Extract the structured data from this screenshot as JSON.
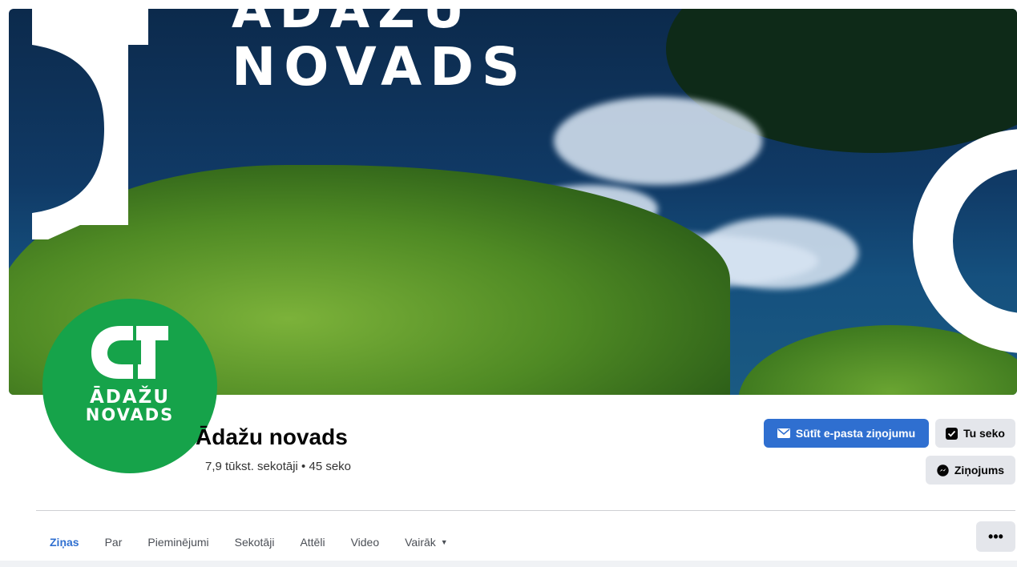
{
  "cover": {
    "title_line1": "ĀDAŽU",
    "title_line2": "NOVADS"
  },
  "profile": {
    "logo_line1": "ĀDAŽU",
    "logo_line2": "NOVADS",
    "brand_color": "#16a34a"
  },
  "page": {
    "name": "Ādažu novads",
    "stats": "7,9 tūkst. sekotāji • 45 seko"
  },
  "actions": {
    "email_label": "Sūtīt e-pasta ziņojumu",
    "email_icon": "envelope-icon",
    "follow_label": "Tu seko",
    "follow_icon": "check-square-icon",
    "message_label": "Ziņojums",
    "message_icon": "messenger-icon",
    "more_label": "•••",
    "accent_color": "#2f6fd0"
  },
  "tabs": [
    {
      "label": "Ziņas",
      "active": true
    },
    {
      "label": "Par"
    },
    {
      "label": "Pieminējumi"
    },
    {
      "label": "Sekotāji"
    },
    {
      "label": "Attēli"
    },
    {
      "label": "Video"
    },
    {
      "label": "Vairāk",
      "dropdown": true
    }
  ]
}
